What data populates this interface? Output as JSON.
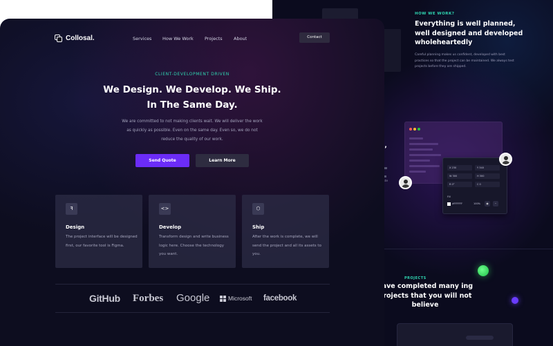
{
  "brand": {
    "name": "Collosal."
  },
  "nav": {
    "items": [
      "Services",
      "How We Work",
      "Projects",
      "About"
    ],
    "contact_label": "Contact"
  },
  "hero": {
    "eyebrow": "CLIENT-DEVELOPMENT DRIVEN",
    "title_line1": "We Design. We Develop. We Ship.",
    "title_line2": "In The Same Day.",
    "body_line1": "We are committed to not making clients wait. We will deliver the work",
    "body_line2": "as quickly as possible. Even on the same day. Even so, we do not",
    "body_line3": "reduce the quality of our work.",
    "primary_cta": "Send Quote",
    "secondary_cta": "Learn More"
  },
  "features": [
    {
      "icon": "figma-icon",
      "glyph": "ꟻ",
      "title": "Design",
      "body": "The project interface will be designed first, our favorite tool is Figma."
    },
    {
      "icon": "code-icon",
      "glyph": "<>",
      "title": "Develop",
      "body": "Transform design and write business logic here. Choose the technology you want."
    },
    {
      "icon": "box-icon",
      "glyph": "⬡",
      "title": "Ship",
      "body": "After the work is complete, we will send the project and all its assets to you."
    }
  ],
  "logos": [
    "GitHub",
    "Forbes",
    "Google",
    "Microsoft",
    "facebook"
  ],
  "how_we_work": {
    "eyebrow": "HOW WE WORK?",
    "title": "Everything is well planned, well designed and developed wholeheartedly",
    "body": "Careful planning makes us confident, developed with best practices so that the project can be maintained. We always test projects before they are shipped."
  },
  "back_fragments": {
    "us": "s,",
    "ate": "rate"
  },
  "properties_panel": {
    "x": "X 230",
    "y": "Y 340",
    "w": "W 300",
    "h": "H 300",
    "r": "R 0°",
    "c": "C 0",
    "fill_label": "Fill",
    "hex": "#FFFFFF",
    "opacity": "100%"
  },
  "projects": {
    "eyebrow": "PROJECTS",
    "title": "have completed many ing projects that you will not believe"
  },
  "colors": {
    "accent": "#6b2cf7",
    "eyebrow": "#2fd5b1",
    "background": "#0d0d1f"
  }
}
